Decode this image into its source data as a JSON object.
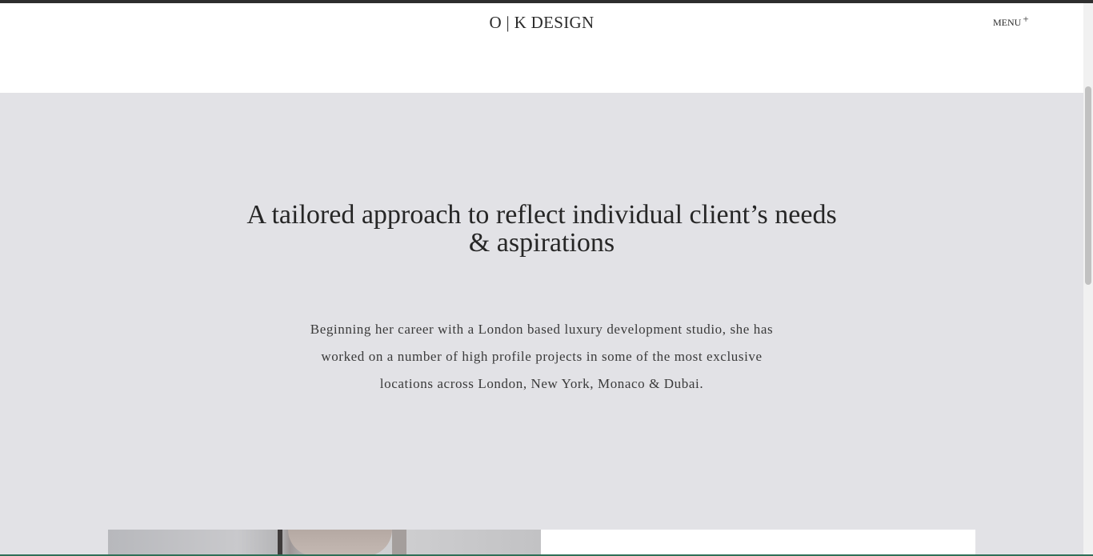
{
  "header": {
    "logo": "O | K DESIGN",
    "menu_label": "MENU",
    "menu_icon": "+"
  },
  "hero": {
    "headline_line1": "A tailored approach to reflect individual client’s needs",
    "headline_line2": "& aspirations",
    "body_line1": "Beginning her career with a London based luxury development studio, she has",
    "body_line2": "worked on a number of high profile projects in some of the most exclusive",
    "body_line3": "locations across London, New York, Monaco & Dubai."
  },
  "colors": {
    "hero_background": "#e2e2e6",
    "text": "#262626",
    "top_strip": "#2e2e2e"
  },
  "scrollbar": {
    "position_fraction": 0.15
  }
}
